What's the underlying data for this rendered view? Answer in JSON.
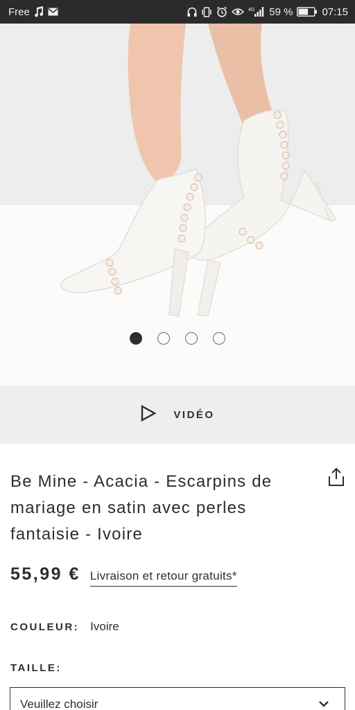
{
  "status_bar": {
    "carrier": "Free",
    "battery_percent": "59 %",
    "time": "07:15",
    "network_label": "4G",
    "left_icons": [
      "music-note-icon",
      "mail-icon"
    ],
    "right_icons": [
      "headphones-icon",
      "vibrate-icon",
      "alarm-icon",
      "eye-icon",
      "signal-icon",
      "battery-icon"
    ]
  },
  "gallery": {
    "image_subject": "white satin pumps with pearls",
    "page_count": 4,
    "active_index": 0
  },
  "video": {
    "label": "VIDÉO",
    "icon": "play-icon"
  },
  "product": {
    "title": "Be Mine - Acacia - Escarpins de mariage en satin avec perles fantaisie - Ivoire",
    "price": "55,99 €",
    "delivery_text": "Livraison et retour gratuits*",
    "share_icon": "share-icon"
  },
  "color": {
    "label": "COULEUR:",
    "value": "Ivoire"
  },
  "size": {
    "label": "TAILLE:",
    "select_value": "Veuillez choisir",
    "icon": "chevron-down-icon"
  },
  "colors": {
    "status_bar_bg": "#2b2b2b",
    "text": "#2d2d2d",
    "video_bar_bg": "#eeeeee",
    "hero_bg": "#ededed"
  }
}
